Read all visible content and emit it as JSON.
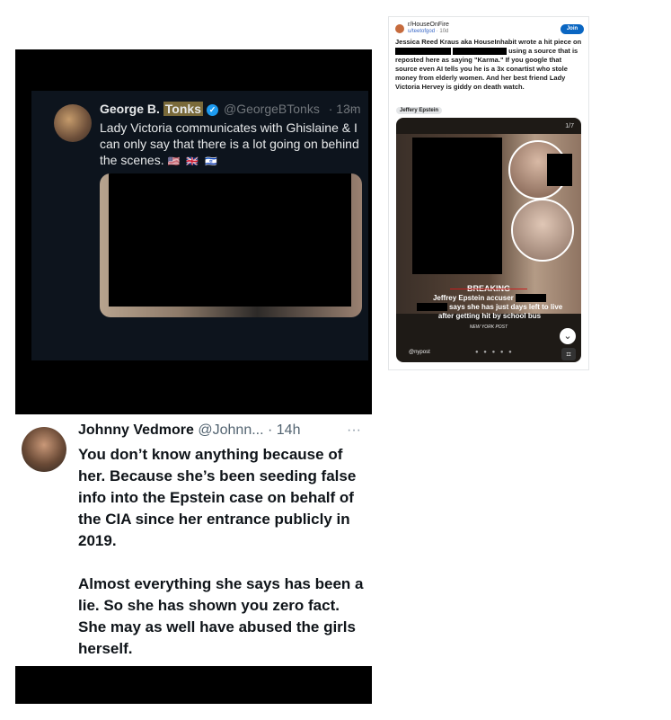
{
  "tweet1": {
    "name_prefix": "George B. ",
    "name_highlight": "Tonks",
    "verified_glyph": "✓",
    "handle": "@GeorgeBTonks",
    "time": "· 13m",
    "more_icon": "···",
    "text": "Lady Victoria communicates with Ghislaine & I can only say that there is a lot going on behind the scenes.",
    "flags": "🇺🇸 🇬🇧 🇮🇱"
  },
  "reddit": {
    "subreddit": "r/HouseOnFire",
    "username": "u/teetofgod",
    "age": "· 10d",
    "join_label": "Join",
    "text_part1": "Jessica Reed Kraus aka HouseInhabit wrote a hit piece on",
    "text_part2": "using a source that is reposted here as saying \"Karma.\" If you google that source even AI tells you he is a 3x conartist who stole money from elderly women. And her best friend Lady Victoria Hervey is giddy on death watch.",
    "flair": "Jeffery Epstein",
    "image": {
      "counter": "1/7",
      "breaking": "BREAKING",
      "headline_part1": "Jeffrey Epstein accuser",
      "headline_part2": "says she has just days left to live after getting hit by school bus",
      "source": "NEW YORK POST",
      "handle": "@nypost",
      "page_dots": "● ● ● ● ●",
      "chevron_icon": "⌄",
      "scan_icon": "⌗"
    }
  },
  "tweet2": {
    "name": "Johnny Vedmore",
    "handle": "@Johnn...",
    "time": "· 14h",
    "more_icon": "···",
    "text": "You don’t know anything because of her. Because she’s been seeding false info into the Epstein case on behalf of the CIA since her entrance publicly in 2019.\n\nAlmost everything she says has been a lie. So she has shown you zero fact. She may as well have abused the girls herself."
  }
}
